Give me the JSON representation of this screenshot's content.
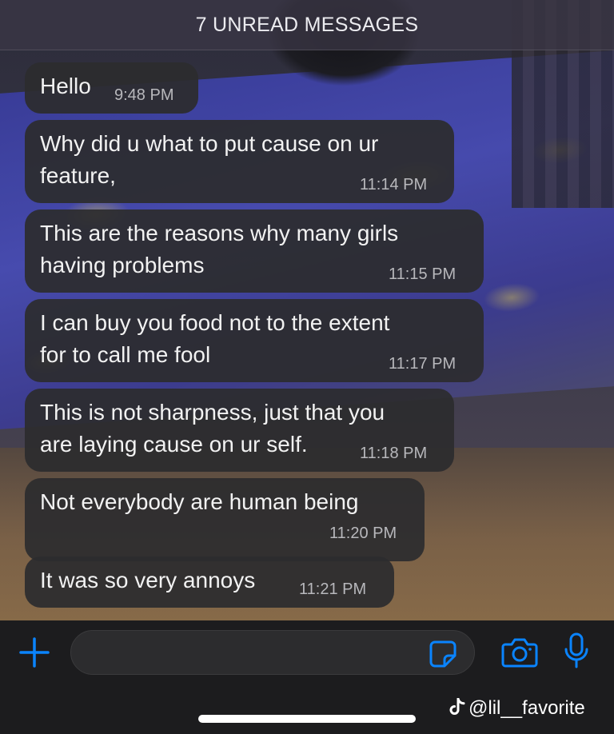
{
  "header": {
    "unread_label": "7 UNREAD MESSAGES"
  },
  "messages": [
    {
      "text": "Hello",
      "time": "9:48 PM"
    },
    {
      "text": "Why did  u what to put cause on ur\nfeature,",
      "time": "11:14 PM"
    },
    {
      "text": "This are the reasons why many girls\nhaving problems",
      "time": "11:15 PM"
    },
    {
      "text": "I can buy you food not to the extent\nfor to call me fool",
      "time": "11:17 PM"
    },
    {
      "text": "This is not sharpness, just that you\nare laying cause on ur self.",
      "time": "11:18 PM"
    },
    {
      "text": "Not everybody are human being",
      "time": "11:20 PM"
    },
    {
      "text": "It was so very annoys",
      "time": "11:21 PM"
    }
  ],
  "input_bar": {
    "add_icon": "plus-icon",
    "sticker_icon": "sticker-icon",
    "camera_icon": "camera-icon",
    "mic_icon": "microphone-icon",
    "accent_color": "#0a84ff"
  },
  "watermark": {
    "icon": "tiktok-icon",
    "handle": "@lil__favorite"
  }
}
